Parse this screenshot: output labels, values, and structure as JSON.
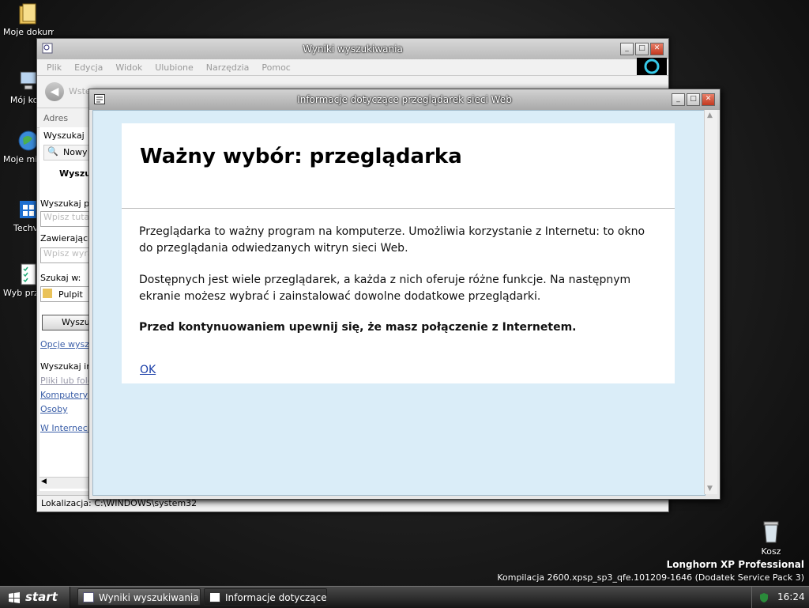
{
  "desktop": {
    "icons": [
      {
        "label": "Moje dokume"
      },
      {
        "label": "Mój kom"
      },
      {
        "label": "Moje mie siecio"
      },
      {
        "label": "Techvo"
      },
      {
        "label": "Wyb przegląd"
      }
    ],
    "recycle_bin": "Kosz",
    "brand_line1": "Longhorn XP Professional",
    "brand_line2": "Kompilacja 2600.xpsp_sp3_qfe.101209-1646 (Dodatek Service Pack 3)"
  },
  "search_window": {
    "title": "Wyniki wyszukiwania",
    "menu": [
      "Plik",
      "Edycja",
      "Widok",
      "Ulubione",
      "Narzędzia",
      "Pomoc"
    ],
    "back_label": "Wstecz",
    "address_label": "Adres",
    "left_pane": {
      "search_header": "Wyszukaj",
      "new_button": "Nowy",
      "search_title": "Wyszuk",
      "file_label": "Wyszukaj plik",
      "file_placeholder": "Wpisz tutaj n",
      "contains_label": "Zawierające t",
      "contains_placeholder": "Wpisz wyraz",
      "look_in_label": "Szukaj w:",
      "look_in_value": "Pulpit",
      "search_button": "Wyszuk",
      "options_link": "Opcje wyszuk",
      "other_label": "Wyszukaj inn",
      "link_files": "Pliki lub folde",
      "link_computers": "Komputery",
      "link_people": "Osoby",
      "link_internet": "W Internecie"
    },
    "status": "Lokalizacja: C:\\WINDOWS\\system32"
  },
  "dialog": {
    "title": "Informacje dotyczące przeglądarek sieci Web",
    "heading": "Ważny wybór: przeglądarka",
    "para1": "Przeglądarka to ważny program na komputerze. Umożliwia korzystanie z Internetu: to okno do przeglądania odwiedzanych witryn sieci Web.",
    "para2": "Dostępnych jest wiele przeglądarek, a każda z nich oferuje różne funkcje. Na następnym ekranie możesz wybrać i zainstalować dowolne dodatkowe przeglądarki.",
    "para3": "Przed kontynuowaniem upewnij się, że masz połączenie z Internetem.",
    "ok": "OK"
  },
  "taskbar": {
    "start": "start",
    "tasks": [
      {
        "label": "Wyniki wyszukiwania"
      },
      {
        "label": "Informacje dotyczące..."
      }
    ],
    "clock": "16:24"
  }
}
